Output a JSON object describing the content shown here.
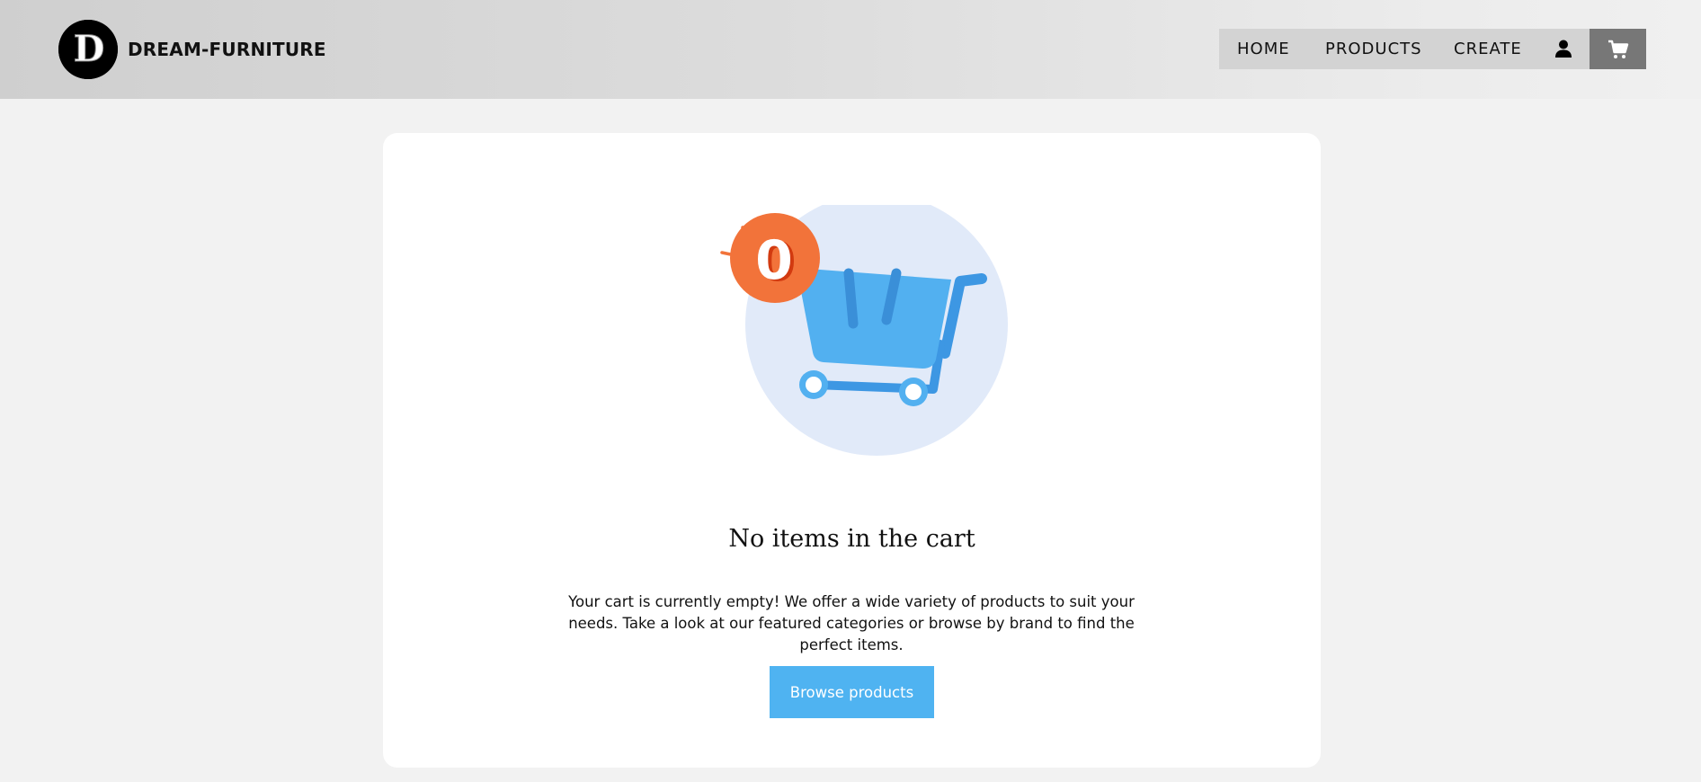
{
  "header": {
    "brand": {
      "logo_letter": "D",
      "name": "DREAM-FURNITURE"
    },
    "nav": {
      "items": [
        {
          "label": "HOME"
        },
        {
          "label": "PRODUCTS"
        },
        {
          "label": "CREATE"
        }
      ],
      "user_icon": "user-icon",
      "cart_icon": "cart-icon"
    }
  },
  "main": {
    "cart_badge_count": "0",
    "empty_title": "No items in the cart",
    "empty_description": "Your cart is currently empty! We offer a wide variety of products to suit your needs. Take a look at our featured categories or browse by brand to find the perfect items.",
    "browse_button_label": "Browse products"
  },
  "colors": {
    "accent_blue": "#4fb3f1",
    "badge_orange": "#f2733a",
    "nav_active": "#777777"
  }
}
